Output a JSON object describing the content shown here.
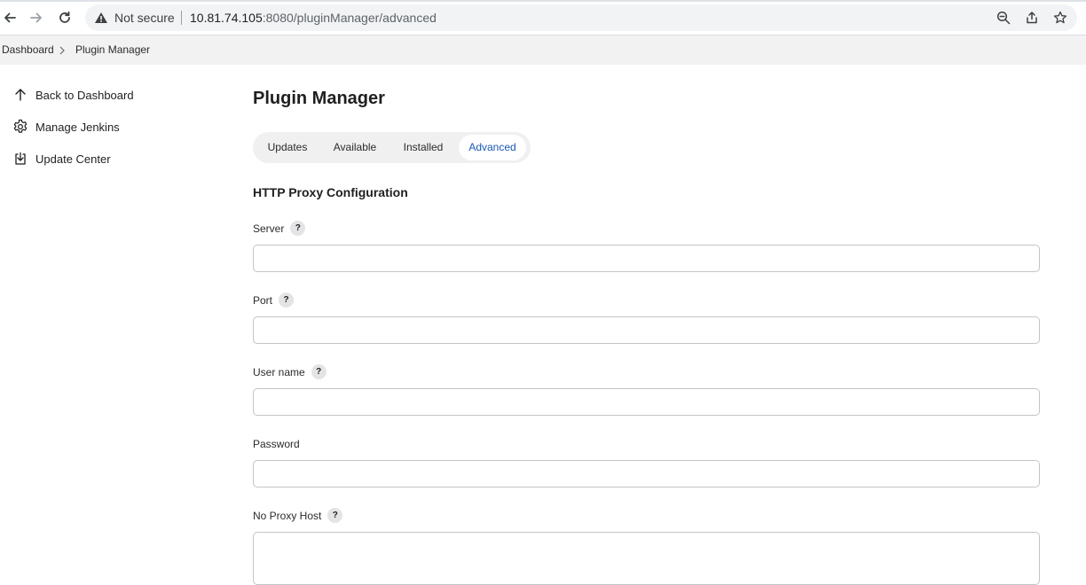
{
  "browser": {
    "security_label": "Not secure",
    "url_host": "10.81.74.105",
    "url_rest": ":8080/pluginManager/advanced",
    "icons": [
      "back-icon",
      "forward-icon",
      "reload-icon",
      "warning-icon",
      "zoom-icon",
      "share-icon",
      "bookmark-star-icon"
    ]
  },
  "breadcrumb": {
    "items": [
      "Dashboard",
      "Plugin Manager"
    ]
  },
  "sidebar": {
    "items": [
      {
        "label": "Back to Dashboard",
        "icon": "arrow-up-icon"
      },
      {
        "label": "Manage Jenkins",
        "icon": "gear-icon"
      },
      {
        "label": "Update Center",
        "icon": "download-icon"
      }
    ]
  },
  "main": {
    "title": "Plugin Manager",
    "tabs": [
      {
        "label": "Updates"
      },
      {
        "label": "Available"
      },
      {
        "label": "Installed"
      },
      {
        "label": "Advanced",
        "active": true
      }
    ],
    "section_title": "HTTP Proxy Configuration",
    "help_glyph": "?",
    "fields": [
      {
        "label": "Server",
        "value": "",
        "has_help": true
      },
      {
        "label": "Port",
        "value": "",
        "has_help": true
      },
      {
        "label": "User name",
        "value": "",
        "has_help": true
      },
      {
        "label": "Password",
        "value": "",
        "has_help": false
      },
      {
        "label": "No Proxy Host",
        "value": "",
        "has_help": true
      }
    ]
  },
  "colors": {
    "accent": "#1b58b7",
    "breadcrumb_bg": "#f2f2f3",
    "tabbar_bg": "#f0f0f1"
  }
}
